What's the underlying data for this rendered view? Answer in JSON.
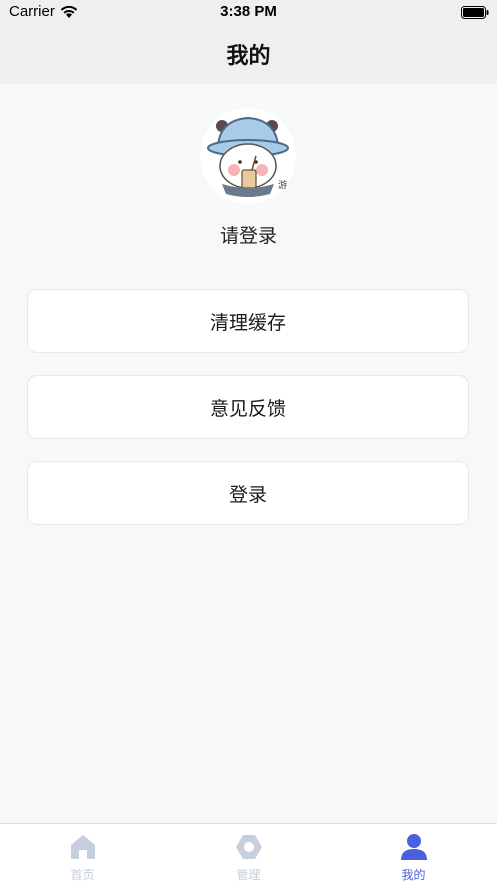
{
  "status_bar": {
    "carrier": "Carrier",
    "time": "3:38 PM"
  },
  "header": {
    "title": "我的"
  },
  "profile": {
    "avatar": "cartoon-bear-avatar",
    "login_prompt": "请登录"
  },
  "menu": {
    "items": [
      {
        "label": "清理缓存"
      },
      {
        "label": "意见反馈"
      },
      {
        "label": "登录"
      }
    ]
  },
  "tab_bar": {
    "tabs": [
      {
        "label": "首页",
        "icon": "home-icon",
        "active": false
      },
      {
        "label": "管理",
        "icon": "hexagon-nut-icon",
        "active": false
      },
      {
        "label": "我的",
        "icon": "person-icon",
        "active": true
      }
    ]
  },
  "colors": {
    "active_tab": "#4a5fe0",
    "inactive_tab": "#c5cfdd",
    "header_bg": "#efefef",
    "page_bg": "#f7f8fa"
  }
}
